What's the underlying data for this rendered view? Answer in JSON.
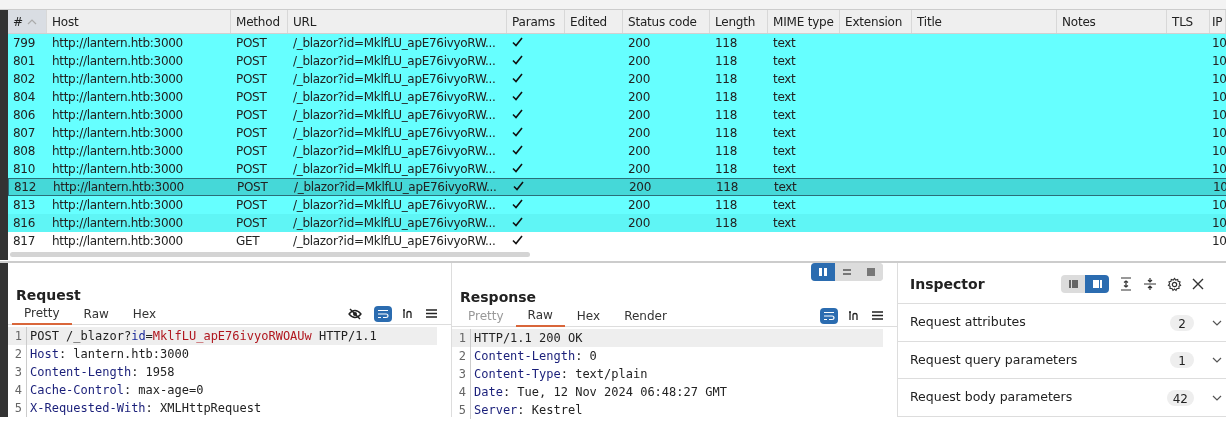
{
  "table": {
    "columns": [
      {
        "label": "#",
        "sorted": true
      },
      {
        "label": "Host",
        "sorted": false
      },
      {
        "label": "Method",
        "sorted": false
      },
      {
        "label": "URL",
        "sorted": false
      },
      {
        "label": "Params",
        "sorted": false
      },
      {
        "label": "Edited",
        "sorted": false
      },
      {
        "label": "Status code",
        "sorted": false
      },
      {
        "label": "Length",
        "sorted": false
      },
      {
        "label": "MIME type",
        "sorted": false
      },
      {
        "label": "Extension",
        "sorted": false
      },
      {
        "label": "Title",
        "sorted": false
      },
      {
        "label": "Notes",
        "sorted": false
      },
      {
        "label": "TLS",
        "sorted": false
      },
      {
        "label": "IP",
        "sorted": false
      }
    ],
    "rows": [
      {
        "id": "799",
        "host": "http://lantern.htb:3000",
        "method": "POST",
        "url": "/_blazor?id=MklfLU_apE76ivyoRW...",
        "params": true,
        "status": "200",
        "length": "118",
        "mime": "text",
        "ip": "10",
        "color": "#66ffff",
        "selected": false
      },
      {
        "id": "801",
        "host": "http://lantern.htb:3000",
        "method": "POST",
        "url": "/_blazor?id=MklfLU_apE76ivyoRW...",
        "params": true,
        "status": "200",
        "length": "118",
        "mime": "text",
        "ip": "10",
        "color": "#66ffff",
        "selected": false
      },
      {
        "id": "802",
        "host": "http://lantern.htb:3000",
        "method": "POST",
        "url": "/_blazor?id=MklfLU_apE76ivyoRW...",
        "params": true,
        "status": "200",
        "length": "118",
        "mime": "text",
        "ip": "10",
        "color": "#66ffff",
        "selected": false
      },
      {
        "id": "804",
        "host": "http://lantern.htb:3000",
        "method": "POST",
        "url": "/_blazor?id=MklfLU_apE76ivyoRW...",
        "params": true,
        "status": "200",
        "length": "118",
        "mime": "text",
        "ip": "10",
        "color": "#66ffff",
        "selected": false
      },
      {
        "id": "806",
        "host": "http://lantern.htb:3000",
        "method": "POST",
        "url": "/_blazor?id=MklfLU_apE76ivyoRW...",
        "params": true,
        "status": "200",
        "length": "118",
        "mime": "text",
        "ip": "10",
        "color": "#66ffff",
        "selected": false
      },
      {
        "id": "807",
        "host": "http://lantern.htb:3000",
        "method": "POST",
        "url": "/_blazor?id=MklfLU_apE76ivyoRW...",
        "params": true,
        "status": "200",
        "length": "118",
        "mime": "text",
        "ip": "10",
        "color": "#66ffff",
        "selected": false
      },
      {
        "id": "808",
        "host": "http://lantern.htb:3000",
        "method": "POST",
        "url": "/_blazor?id=MklfLU_apE76ivyoRW...",
        "params": true,
        "status": "200",
        "length": "118",
        "mime": "text",
        "ip": "10",
        "color": "#66ffff",
        "selected": false
      },
      {
        "id": "810",
        "host": "http://lantern.htb:3000",
        "method": "POST",
        "url": "/_blazor?id=MklfLU_apE76ivyoRW...",
        "params": true,
        "status": "200",
        "length": "118",
        "mime": "text",
        "ip": "10",
        "color": "#66ffff",
        "selected": false
      },
      {
        "id": "812",
        "host": "http://lantern.htb:3000",
        "method": "POST",
        "url": "/_blazor?id=MklfLU_apE76ivyoRW...",
        "params": true,
        "status": "200",
        "length": "118",
        "mime": "text",
        "ip": "10",
        "color": "#45d8d8",
        "selected": true
      },
      {
        "id": "813",
        "host": "http://lantern.htb:3000",
        "method": "POST",
        "url": "/_blazor?id=MklfLU_apE76ivyoRW...",
        "params": true,
        "status": "200",
        "length": "118",
        "mime": "text",
        "ip": "10",
        "color": "#66ffff",
        "selected": false
      },
      {
        "id": "816",
        "host": "http://lantern.htb:3000",
        "method": "POST",
        "url": "/_blazor?id=MklfLU_apE76ivyoRW...",
        "params": true,
        "status": "200",
        "length": "118",
        "mime": "text",
        "ip": "10",
        "color": "#5ff5f5",
        "selected": false
      },
      {
        "id": "817",
        "host": "http://lantern.htb:3000",
        "method": "GET",
        "url": "/_blazor?id=MklfLU_apE76ivyoRW...",
        "params": true,
        "ip": "10",
        "color": "#ffffff",
        "selected": false
      }
    ]
  },
  "request": {
    "title": "Request",
    "tabs": [
      {
        "label": "Pretty",
        "selected": true
      },
      {
        "label": "Raw",
        "selected": false
      },
      {
        "label": "Hex",
        "selected": false
      }
    ],
    "wrap_on": true,
    "lines": [
      {
        "number": "1",
        "segments": [
          {
            "kind": "plain",
            "text": "POST /_blazor?"
          },
          {
            "kind": "param_name",
            "text": "id"
          },
          {
            "kind": "plain",
            "text": "="
          },
          {
            "kind": "param_value",
            "text": "MklfLU_apE76ivyoRWOAUw"
          },
          {
            "kind": "plain",
            "text": " HTTP/1.1"
          }
        ]
      },
      {
        "number": "2",
        "segments": [
          {
            "kind": "header_name",
            "text": "Host"
          },
          {
            "kind": "plain",
            "text": ": lantern.htb:3000"
          }
        ]
      },
      {
        "number": "3",
        "segments": [
          {
            "kind": "header_name",
            "text": "Content-Length"
          },
          {
            "kind": "plain",
            "text": ": 1958"
          }
        ]
      },
      {
        "number": "4",
        "segments": [
          {
            "kind": "header_name",
            "text": "Cache-Control"
          },
          {
            "kind": "plain",
            "text": ": max-age=0"
          }
        ]
      },
      {
        "number": "5",
        "segments": [
          {
            "kind": "header_name",
            "text": "X-Requested-With"
          },
          {
            "kind": "plain",
            "text": ": XMLHttpRequest"
          }
        ]
      }
    ]
  },
  "response": {
    "title": "Response",
    "tabs": [
      {
        "label": "Pretty",
        "selected": false,
        "disabled": true
      },
      {
        "label": "Raw",
        "selected": true,
        "disabled": false
      },
      {
        "label": "Hex",
        "selected": false,
        "disabled": false
      },
      {
        "label": "Render",
        "selected": false,
        "disabled": false
      }
    ],
    "wrap_on": true,
    "lines": [
      {
        "number": "1",
        "segments": [
          {
            "kind": "plain",
            "text": "HTTP/1.1 200 OK"
          }
        ]
      },
      {
        "number": "2",
        "segments": [
          {
            "kind": "header_name",
            "text": "Content-Length"
          },
          {
            "kind": "plain",
            "text": ": 0"
          }
        ]
      },
      {
        "number": "3",
        "segments": [
          {
            "kind": "header_name",
            "text": "Content-Type"
          },
          {
            "kind": "plain",
            "text": ": text/plain"
          }
        ]
      },
      {
        "number": "4",
        "segments": [
          {
            "kind": "header_name",
            "text": "Date"
          },
          {
            "kind": "plain",
            "text": ": Tue, 12 Nov 2024 06:48:27 GMT"
          }
        ]
      },
      {
        "number": "5",
        "segments": [
          {
            "kind": "header_name",
            "text": "Server"
          },
          {
            "kind": "plain",
            "text": ": Kestrel"
          }
        ]
      }
    ]
  },
  "layout_toggle": [
    {
      "kind": "columns",
      "selected": true
    },
    {
      "kind": "rows",
      "selected": false
    },
    {
      "kind": "single",
      "selected": false
    }
  ],
  "inspector": {
    "title": "Inspector",
    "view_toggle": [
      {
        "kind": "left",
        "selected": false
      },
      {
        "kind": "right",
        "selected": true
      }
    ],
    "sections": [
      {
        "label": "Request attributes",
        "count": "2"
      },
      {
        "label": "Request query parameters",
        "count": "1"
      },
      {
        "label": "Request body parameters",
        "count": "42"
      }
    ]
  }
}
